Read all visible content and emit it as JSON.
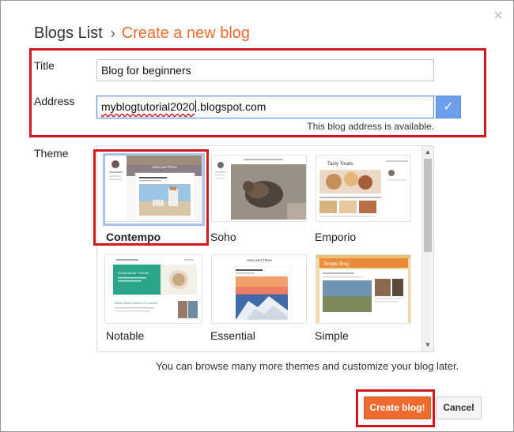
{
  "header": {
    "breadcrumb_root": "Blogs List",
    "breadcrumb_separator": "›",
    "breadcrumb_current": "Create a new blog",
    "close_glyph": "×"
  },
  "form": {
    "title_label": "Title",
    "title_value": "Blog for beginners",
    "address_label": "Address",
    "address_value_before_caret": "myblogtutorial2020",
    "address_value_after_caret": ".blogspot.com",
    "address_status": "This blog address is available.",
    "check_glyph": "✓"
  },
  "theme_section": {
    "label": "Theme",
    "selected": "Contempo",
    "themes": [
      {
        "name": "Contempo",
        "mini_title": "Here and There"
      },
      {
        "name": "Soho"
      },
      {
        "name": "Emporio",
        "mini_title": "Tasty Treats"
      },
      {
        "name": "Notable",
        "mini_title": "Social Media \"Friends\"",
        "mini_subtitle": "What's Better Between It Sounds?"
      },
      {
        "name": "Essential",
        "mini_title": "Here and There"
      },
      {
        "name": "Simple",
        "mini_title": "Simple Blog"
      }
    ],
    "browse_note": "You can browse many more themes and customize your blog later."
  },
  "actions": {
    "create_label": "Create blog!",
    "cancel_label": "Cancel"
  },
  "colors": {
    "accent_orange": "#ef6c2e",
    "highlight_red": "#d0181e",
    "check_blue": "#6d9eeb"
  }
}
